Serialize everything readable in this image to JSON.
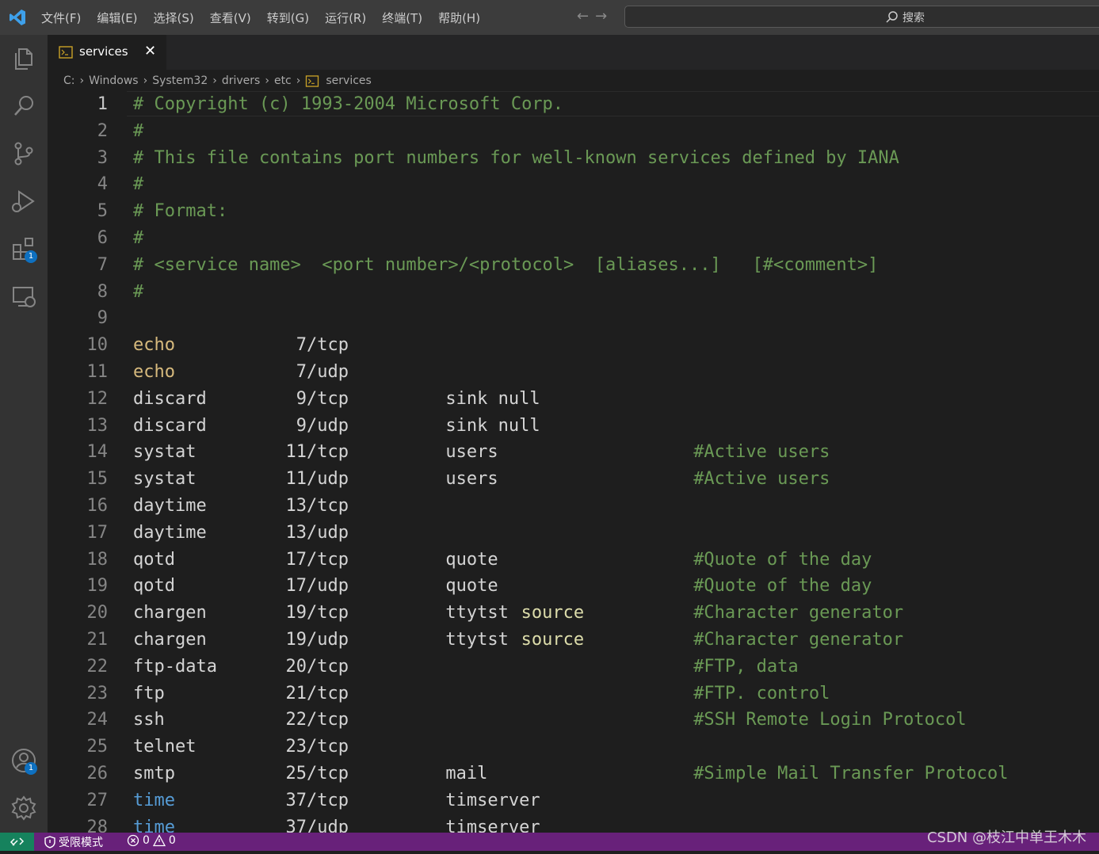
{
  "titlebar": {
    "menu": [
      "文件(F)",
      "编辑(E)",
      "选择(S)",
      "查看(V)",
      "转到(G)",
      "运行(R)",
      "终端(T)",
      "帮助(H)"
    ],
    "back_icon": "arrow-left-icon",
    "forward_icon": "arrow-right-icon",
    "search_placeholder": "搜索"
  },
  "activitybar": {
    "items": [
      "explorer-icon",
      "search-icon",
      "source-control-icon",
      "run-debug-icon",
      "extensions-icon",
      "remote-explorer-icon"
    ],
    "extensions_badge": "1",
    "accounts_badge": "1"
  },
  "tab": {
    "label": "services",
    "close": "✕"
  },
  "breadcrumb": [
    "C:",
    "Windows",
    "System32",
    "drivers",
    "etc",
    "services"
  ],
  "editor": {
    "lines": [
      {
        "n": "1",
        "comment": "# Copyright (c) 1993-2004 Microsoft Corp."
      },
      {
        "n": "2",
        "comment": "#"
      },
      {
        "n": "3",
        "comment": "# This file contains port numbers for well-known services defined by IANA"
      },
      {
        "n": "4",
        "comment": "#"
      },
      {
        "n": "5",
        "comment": "# Format:"
      },
      {
        "n": "6",
        "comment": "#"
      },
      {
        "n": "7",
        "comment": "# <service name>  <port number>/<protocol>  [aliases...]   [#<comment>]"
      },
      {
        "n": "8",
        "comment": "#"
      },
      {
        "n": "9"
      },
      {
        "n": "10",
        "service": "echo",
        "port": "7/tcp",
        "style": "svc"
      },
      {
        "n": "11",
        "service": "echo",
        "port": "7/udp",
        "style": "svc"
      },
      {
        "n": "12",
        "service": "discard",
        "port": "9/tcp",
        "aliases": "sink null"
      },
      {
        "n": "13",
        "service": "discard",
        "port": "9/udp",
        "aliases": "sink null"
      },
      {
        "n": "14",
        "service": "systat",
        "port": "11/tcp",
        "aliases": "users",
        "note": "#Active users"
      },
      {
        "n": "15",
        "service": "systat",
        "port": "11/udp",
        "aliases": "users",
        "note": "#Active users"
      },
      {
        "n": "16",
        "service": "daytime",
        "port": "13/tcp"
      },
      {
        "n": "17",
        "service": "daytime",
        "port": "13/udp"
      },
      {
        "n": "18",
        "service": "qotd",
        "port": "17/tcp",
        "aliases": "quote",
        "note": "#Quote of the day"
      },
      {
        "n": "19",
        "service": "qotd",
        "port": "17/udp",
        "aliases": "quote",
        "note": "#Quote of the day"
      },
      {
        "n": "20",
        "service": "chargen",
        "port": "19/tcp",
        "aliases": "ttytst",
        "alias2": "source",
        "note": "#Character generator"
      },
      {
        "n": "21",
        "service": "chargen",
        "port": "19/udp",
        "aliases": "ttytst",
        "alias2": "source",
        "note": "#Character generator"
      },
      {
        "n": "22",
        "service": "ftp-data",
        "port": "20/tcp",
        "note": "#FTP, data"
      },
      {
        "n": "23",
        "service": "ftp",
        "port": "21/tcp",
        "note": "#FTP. control"
      },
      {
        "n": "24",
        "service": "ssh",
        "port": "22/tcp",
        "note": "#SSH Remote Login Protocol"
      },
      {
        "n": "25",
        "service": "telnet",
        "port": "23/tcp"
      },
      {
        "n": "26",
        "service": "smtp",
        "port": "25/tcp",
        "aliases": "mail",
        "note": "#Simple Mail Transfer Protocol"
      },
      {
        "n": "27",
        "service": "time",
        "port": "37/tcp",
        "aliases": "timserver",
        "style": "kw"
      },
      {
        "n": "28",
        "service": "time",
        "port": "37/udp",
        "aliases": "timserver",
        "style": "kw"
      }
    ]
  },
  "statusbar": {
    "restricted_mode": "受限模式",
    "errors": "0",
    "warnings": "0",
    "watermark": "CSDN @枝江中单王木木"
  },
  "colors": {
    "comment": "#6a9955",
    "keyword": "#569cd6",
    "statusbar": "#68217a",
    "remote": "#16825d",
    "badge": "#0e70c0"
  }
}
